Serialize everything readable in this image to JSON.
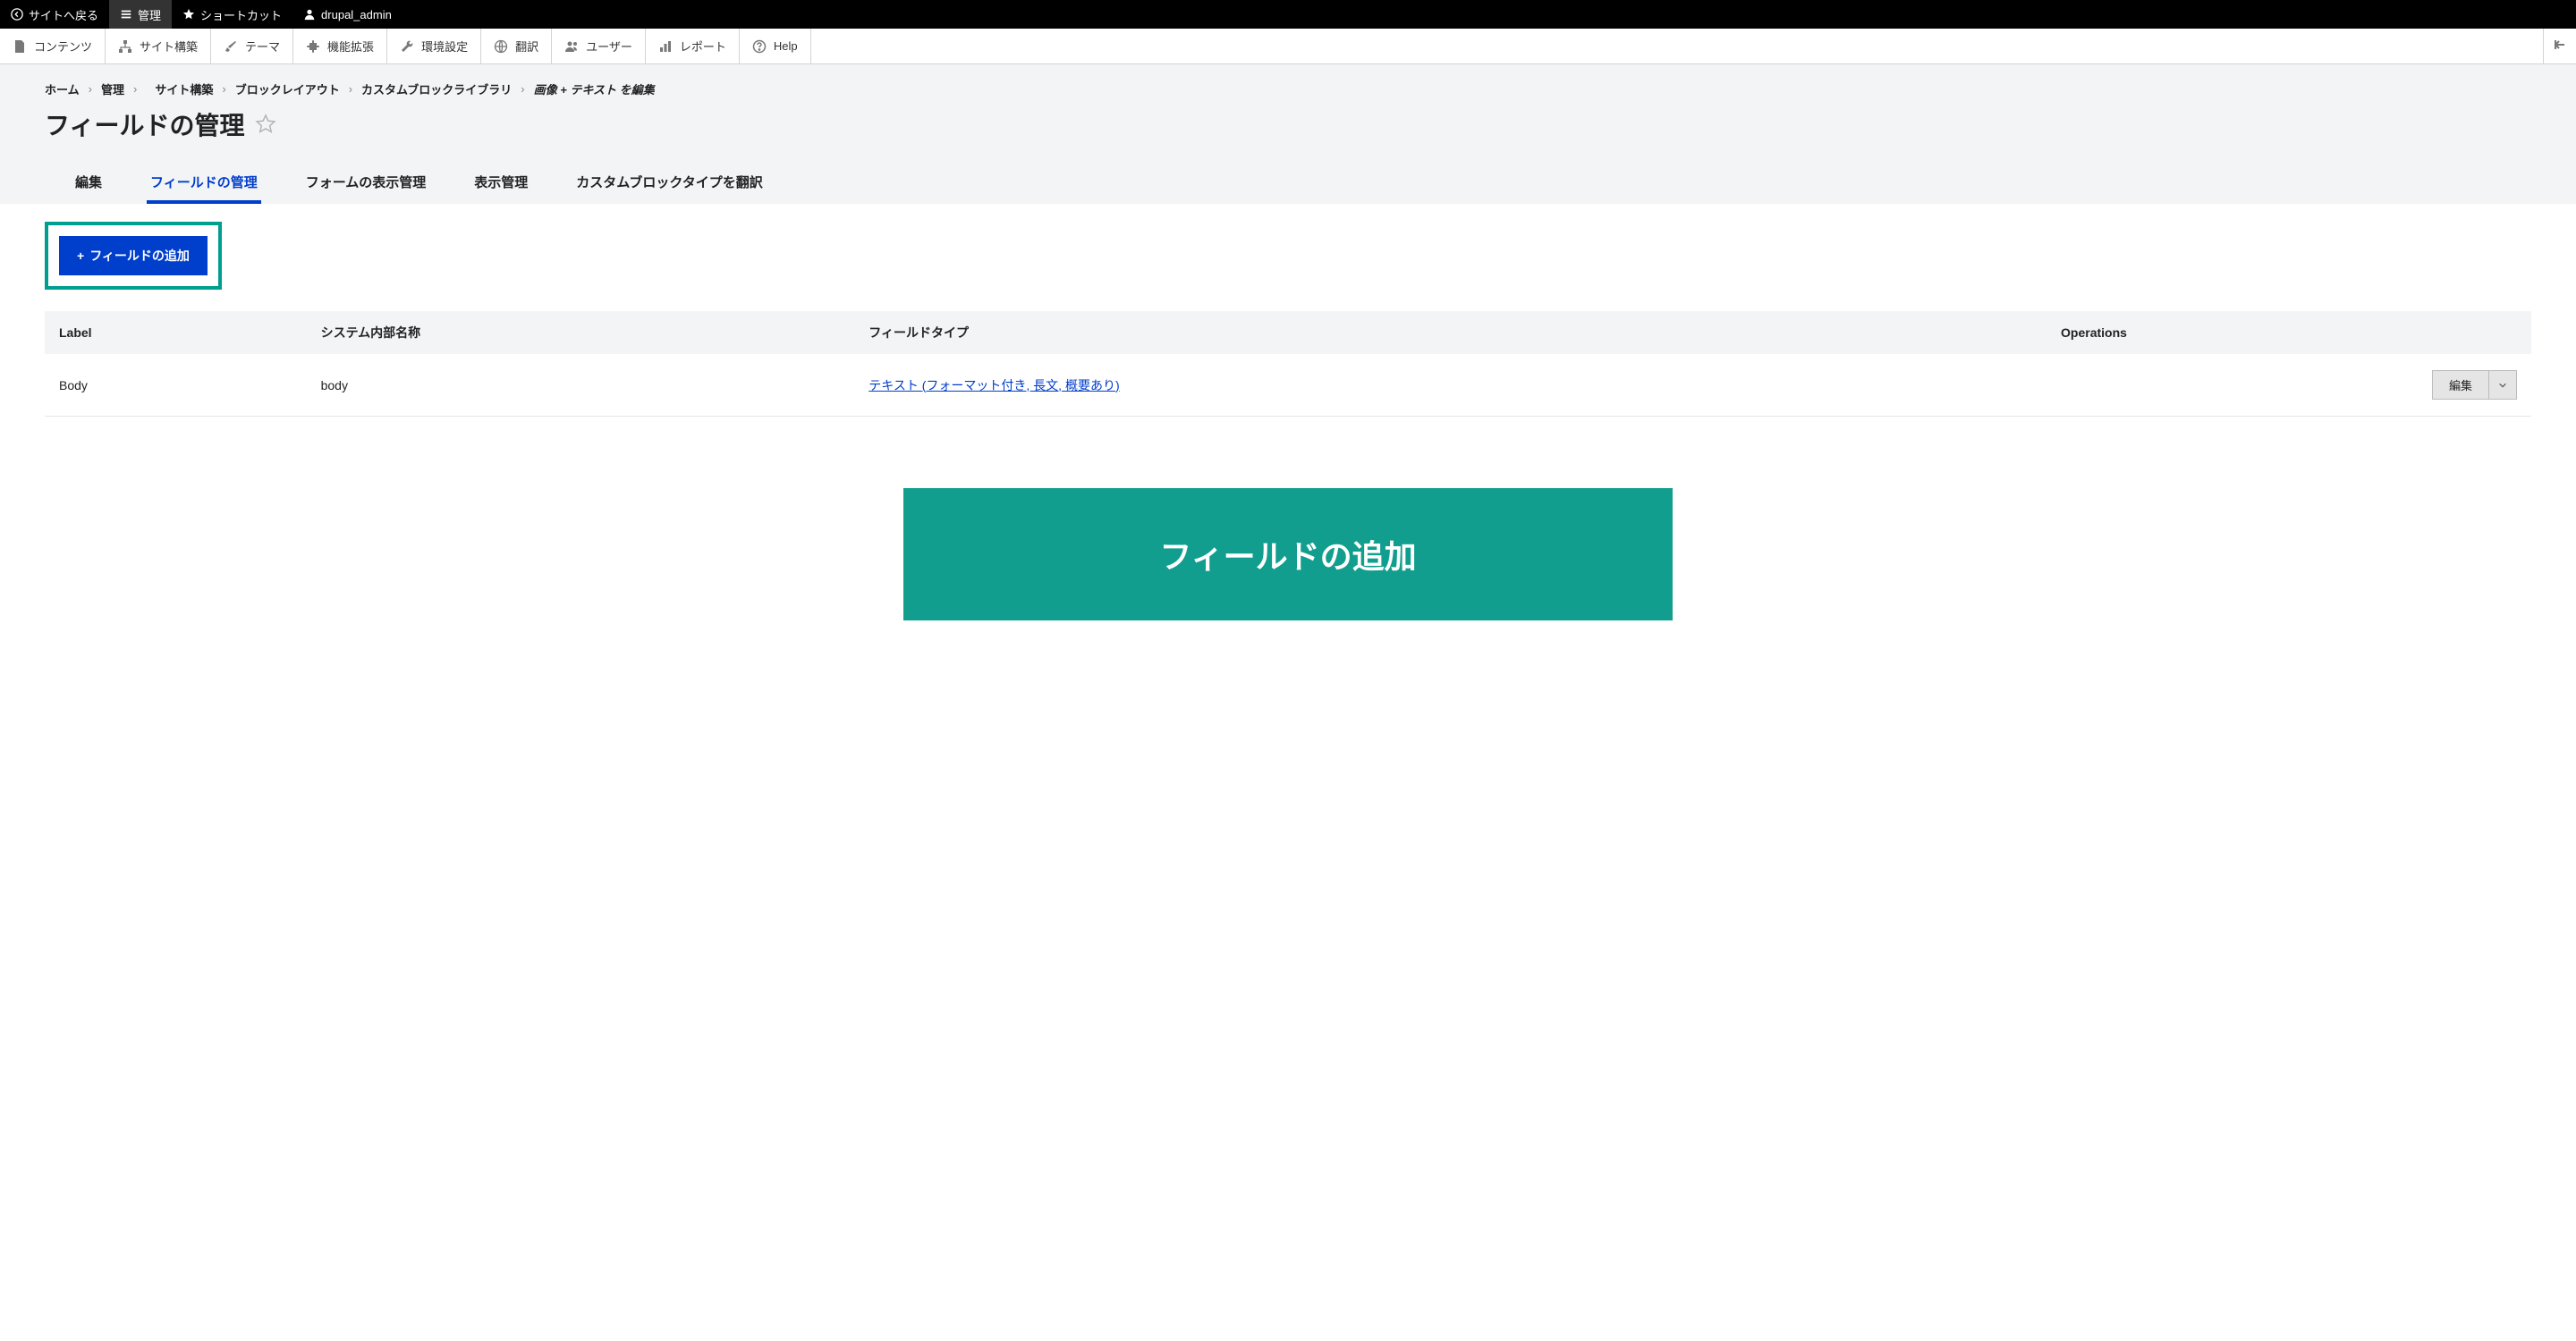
{
  "topbar": {
    "back": "サイトへ戻る",
    "manage": "管理",
    "shortcuts": "ショートカット",
    "user": "drupal_admin"
  },
  "toolbar": {
    "content": "コンテンツ",
    "structure": "サイト構築",
    "appearance": "テーマ",
    "extend": "機能拡張",
    "configuration": "環境設定",
    "translate": "翻訳",
    "people": "ユーザー",
    "reports": "レポート",
    "help": "Help"
  },
  "breadcrumb": {
    "items": [
      {
        "label": "ホーム"
      },
      {
        "label": "管理"
      },
      {
        "label": "サイト構築"
      },
      {
        "label": "ブロックレイアウト"
      },
      {
        "label": "カスタムブロックライブラリ"
      },
      {
        "label": "画像 + テキスト を編集",
        "current": true
      }
    ],
    "separator": "›"
  },
  "page_title": "フィールドの管理",
  "tabs": [
    {
      "label": "編集",
      "active": false
    },
    {
      "label": "フィールドの管理",
      "active": true
    },
    {
      "label": "フォームの表示管理",
      "active": false
    },
    {
      "label": "表示管理",
      "active": false
    },
    {
      "label": "カスタムブロックタイプを翻訳",
      "active": false
    }
  ],
  "add_field_button": "フィールドの追加",
  "table": {
    "headers": {
      "label": "Label",
      "machine_name": "システム内部名称",
      "field_type": "フィールドタイプ",
      "operations": "Operations"
    },
    "rows": [
      {
        "label": "Body",
        "machine_name": "body",
        "field_type": "テキスト (フォーマット付き, 長文, 概要あり)",
        "op_label": "編集"
      }
    ]
  },
  "banner": "フィールドの追加"
}
